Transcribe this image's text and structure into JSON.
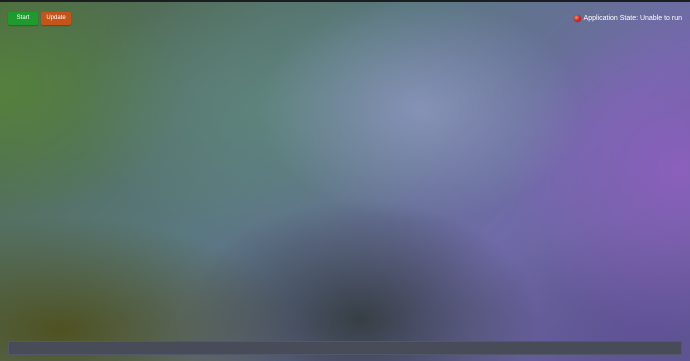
{
  "toolbar": {
    "start_label": "Start",
    "update_label": "Update"
  },
  "status": {
    "label": "Application State: Unable to run",
    "indicator_color": "#e02a1a",
    "icon": "red-circle-icon"
  },
  "colors": {
    "start_button": "#1f9a2f",
    "update_button": "#c5541a",
    "console_bar": "#474c58"
  }
}
